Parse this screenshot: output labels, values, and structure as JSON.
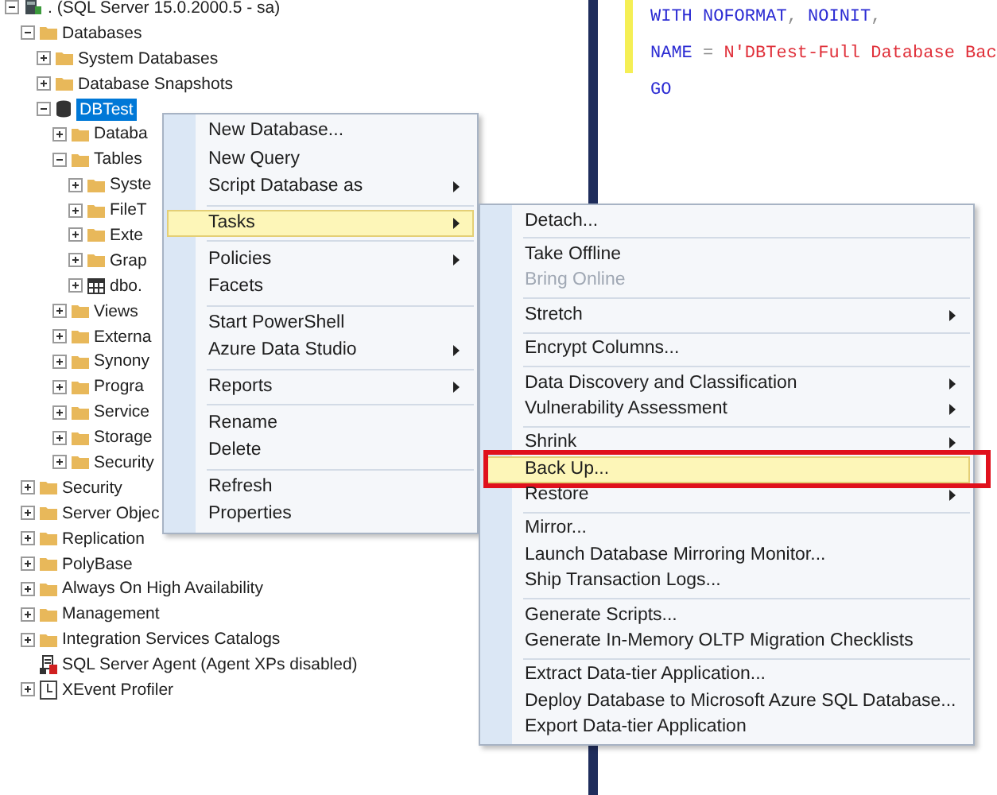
{
  "object_explorer": {
    "tree": [
      {
        "label": ". (SQL Server 15.0.2000.5 - sa)",
        "kind": "server",
        "expanded": true,
        "selected": false,
        "children": [
          {
            "label": "Databases",
            "kind": "folder",
            "expanded": true,
            "selected": false,
            "children": [
              {
                "label": "System Databases",
                "kind": "folder",
                "expanded": false,
                "selected": false
              },
              {
                "label": "Database Snapshots",
                "kind": "folder",
                "expanded": false,
                "selected": false
              },
              {
                "label": "DBTest",
                "kind": "database",
                "expanded": true,
                "selected": true,
                "children": [
                  {
                    "label": "Databa",
                    "kind": "folder",
                    "expanded": false,
                    "selected": false
                  },
                  {
                    "label": "Tables",
                    "kind": "folder",
                    "expanded": true,
                    "selected": false,
                    "children": [
                      {
                        "label": "Syste",
                        "kind": "folder",
                        "expanded": false,
                        "selected": false
                      },
                      {
                        "label": "FileT",
                        "kind": "folder",
                        "expanded": false,
                        "selected": false
                      },
                      {
                        "label": "Exte",
                        "kind": "folder",
                        "expanded": false,
                        "selected": false
                      },
                      {
                        "label": "Grap",
                        "kind": "folder",
                        "expanded": false,
                        "selected": false
                      },
                      {
                        "label": "dbo.",
                        "kind": "table",
                        "expanded": false,
                        "selected": false
                      }
                    ]
                  },
                  {
                    "label": "Views",
                    "kind": "folder",
                    "expanded": false,
                    "selected": false
                  },
                  {
                    "label": "Externa",
                    "kind": "folder",
                    "expanded": false,
                    "selected": false
                  },
                  {
                    "label": "Synony",
                    "kind": "folder",
                    "expanded": false,
                    "selected": false
                  },
                  {
                    "label": "Progra",
                    "kind": "folder",
                    "expanded": false,
                    "selected": false
                  },
                  {
                    "label": "Service",
                    "kind": "folder",
                    "expanded": false,
                    "selected": false
                  },
                  {
                    "label": "Storage",
                    "kind": "folder",
                    "expanded": false,
                    "selected": false
                  },
                  {
                    "label": "Security",
                    "kind": "folder",
                    "expanded": false,
                    "selected": false
                  }
                ]
              }
            ]
          },
          {
            "label": "Security",
            "kind": "folder",
            "expanded": false,
            "selected": false
          },
          {
            "label": "Server Objec",
            "kind": "folder",
            "expanded": false,
            "selected": false
          },
          {
            "label": "Replication",
            "kind": "folder",
            "expanded": false,
            "selected": false
          },
          {
            "label": "PolyBase",
            "kind": "folder",
            "expanded": false,
            "selected": false
          },
          {
            "label": "Always On High Availability",
            "kind": "folder",
            "expanded": false,
            "selected": false
          },
          {
            "label": "Management",
            "kind": "folder",
            "expanded": false,
            "selected": false
          },
          {
            "label": "Integration Services Catalogs",
            "kind": "folder",
            "expanded": false,
            "selected": false
          },
          {
            "label": "SQL Server Agent (Agent XPs disabled)",
            "kind": "agent",
            "selected": false
          },
          {
            "label": "XEvent Profiler",
            "kind": "profiler",
            "expanded": false,
            "selected": false
          }
        ]
      }
    ]
  },
  "editor": {
    "lines": [
      [
        {
          "text": "WITH NOFORMAT",
          "kind": "keyword"
        },
        {
          "text": ", ",
          "kind": "operator"
        },
        {
          "text": "NOINIT",
          "kind": "keyword"
        },
        {
          "text": ",",
          "kind": "operator"
        }
      ],
      [
        {
          "text": "NAME",
          "kind": "keyword"
        },
        {
          "text": " = ",
          "kind": "operator"
        },
        {
          "text": "N'DBTest-Full Database Bac",
          "kind": "string"
        }
      ],
      [
        {
          "text": "GO",
          "kind": "keyword"
        }
      ]
    ]
  },
  "context_menu": {
    "groups": [
      [
        {
          "label": "New Database...",
          "submenu": false,
          "selected": false
        },
        {
          "label": "New Query",
          "submenu": false,
          "selected": false
        },
        {
          "label": "Script Database as",
          "submenu": true,
          "selected": false
        }
      ],
      [
        {
          "label": "Tasks",
          "submenu": true,
          "selected": true
        }
      ],
      [
        {
          "label": "Policies",
          "submenu": true,
          "selected": false
        },
        {
          "label": "Facets",
          "submenu": false,
          "selected": false
        }
      ],
      [
        {
          "label": "Start PowerShell",
          "submenu": false,
          "selected": false
        },
        {
          "label": "Azure Data Studio",
          "submenu": true,
          "selected": false
        }
      ],
      [
        {
          "label": "Reports",
          "submenu": true,
          "selected": false
        }
      ],
      [
        {
          "label": "Rename",
          "submenu": false,
          "selected": false
        },
        {
          "label": "Delete",
          "submenu": false,
          "selected": false
        }
      ],
      [
        {
          "label": "Refresh",
          "submenu": false,
          "selected": false
        },
        {
          "label": "Properties",
          "submenu": false,
          "selected": false
        }
      ]
    ]
  },
  "tasks_submenu": {
    "groups": [
      [
        {
          "label": "Detach...",
          "submenu": false,
          "selected": false,
          "disabled": false
        }
      ],
      [
        {
          "label": "Take Offline",
          "submenu": false,
          "selected": false,
          "disabled": false
        },
        {
          "label": "Bring Online",
          "submenu": false,
          "selected": false,
          "disabled": true
        }
      ],
      [
        {
          "label": "Stretch",
          "submenu": true,
          "selected": false,
          "disabled": false
        }
      ],
      [
        {
          "label": "Encrypt Columns...",
          "submenu": false,
          "selected": false,
          "disabled": false
        }
      ],
      [
        {
          "label": "Data Discovery and Classification",
          "submenu": true,
          "selected": false,
          "disabled": false
        },
        {
          "label": "Vulnerability Assessment",
          "submenu": true,
          "selected": false,
          "disabled": false
        }
      ],
      [
        {
          "label": "Shrink",
          "submenu": true,
          "selected": false,
          "disabled": false
        },
        {
          "label": "Back Up...",
          "submenu": false,
          "selected": true,
          "disabled": false
        },
        {
          "label": "Restore",
          "submenu": true,
          "selected": false,
          "disabled": false
        }
      ],
      [
        {
          "label": "Mirror...",
          "submenu": false,
          "selected": false,
          "disabled": false
        },
        {
          "label": "Launch Database Mirroring Monitor...",
          "submenu": false,
          "selected": false,
          "disabled": false
        },
        {
          "label": "Ship Transaction Logs...",
          "submenu": false,
          "selected": false,
          "disabled": false
        }
      ],
      [
        {
          "label": "Generate Scripts...",
          "submenu": false,
          "selected": false,
          "disabled": false
        },
        {
          "label": "Generate In-Memory OLTP Migration Checklists",
          "submenu": false,
          "selected": false,
          "disabled": false
        }
      ],
      [
        {
          "label": "Extract Data-tier Application...",
          "submenu": false,
          "selected": false,
          "disabled": false
        },
        {
          "label": "Deploy Database to Microsoft Azure SQL Database...",
          "submenu": false,
          "selected": false,
          "disabled": false
        },
        {
          "label": "Export Data-tier Application",
          "submenu": false,
          "selected": false,
          "disabled": false
        }
      ]
    ]
  }
}
